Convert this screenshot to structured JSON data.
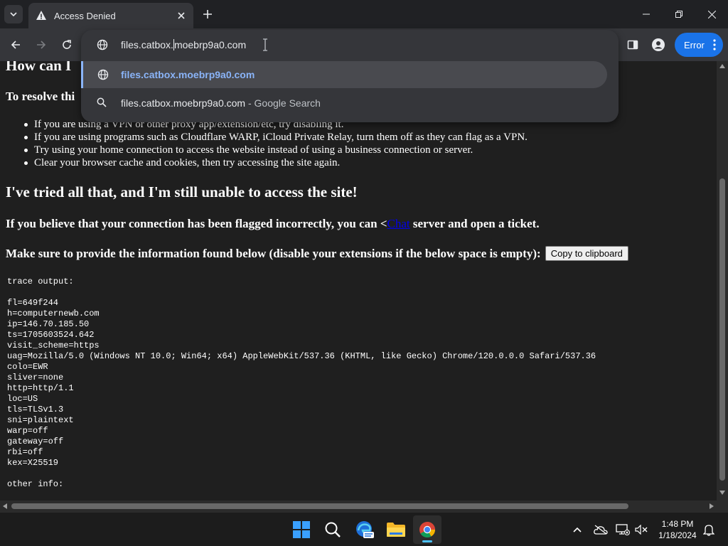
{
  "browser": {
    "tab_title": "Access Denied",
    "address_text": "files.catbox.moebrp9a0.com",
    "address_before_caret": "files.catbox.",
    "address_after_caret": "moebrp9a0.com",
    "suggestions": [
      {
        "text": "files.catbox.moebrp9a0.com",
        "icon": "globe-icon"
      },
      {
        "text": "files.catbox.moebrp9a0.com",
        "sub": " - Google Search",
        "icon": "search-icon"
      }
    ],
    "profile_status": "Error",
    "accent_color": "#1a73e8"
  },
  "page": {
    "heading_top": "How can I",
    "resolve_text": "To resolve thi",
    "tips": [
      "If you are using a VPN or other proxy app/extension/etc, try disabling it.",
      "If you are using programs such as Cloudflare WARP, iCloud Private Relay, turn them off as they can flag as a VPN.",
      "Try using your home connection to access the website instead of using a business connection or server.",
      "Clear your browser cache and cookies, then try accessing the site again."
    ],
    "heading_tried": "I've tried all that, and I'm still unable to access the site!",
    "believe_prefix": "If you believe that your connection has been flagged incorrectly, you can <",
    "believe_link": "Chat",
    "believe_suffix": " server and open a ticket.",
    "makesure_text": "Make sure to provide the information found below (disable your extensions if the below space is empty):",
    "copy_button": "Copy to clipboard",
    "trace_lines": [
      "trace output:",
      "",
      "fl=649f244",
      "h=computernewb.com",
      "ip=146.70.185.50",
      "ts=1705603524.642",
      "visit_scheme=https",
      "uag=Mozilla/5.0 (Windows NT 10.0; Win64; x64) AppleWebKit/537.36 (KHTML, like Gecko) Chrome/120.0.0.0 Safari/537.36",
      "colo=EWR",
      "sliver=none",
      "http=http/1.1",
      "loc=US",
      "tls=TLSv1.3",
      "sni=plaintext",
      "warp=off",
      "gateway=off",
      "rbi=off",
      "kex=X25519",
      "",
      "other info:"
    ]
  },
  "taskbar": {
    "time": "1:48 PM",
    "date": "1/18/2024",
    "apps": [
      "windows-start-icon",
      "search-icon",
      "edge-pre-icon",
      "file-explorer-icon",
      "chrome-icon"
    ]
  }
}
